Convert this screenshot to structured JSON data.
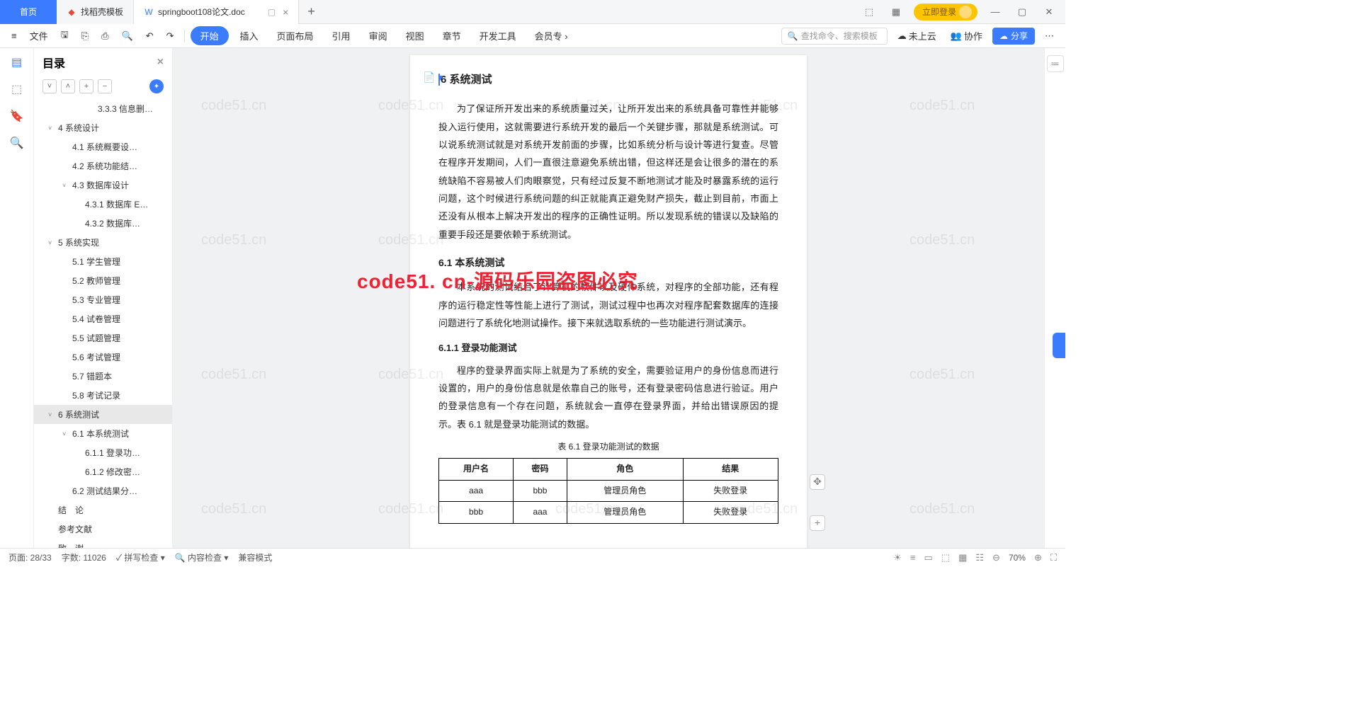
{
  "tabs": {
    "home": "首页",
    "t1": "找稻壳模板",
    "t2": "springboot108论文.doc"
  },
  "login": "立即登录",
  "toolbar": {
    "file": "文件",
    "menus": [
      "开始",
      "插入",
      "页面布局",
      "引用",
      "审阅",
      "视图",
      "章节",
      "开发工具",
      "会员专"
    ],
    "search_ph": "查找命令、搜索模板",
    "cloud": "未上云",
    "collab": "协作",
    "share": "分享"
  },
  "sidebar": {
    "title": "目录"
  },
  "toc": [
    {
      "t": "3.3.3 信息删…",
      "lvl": 4
    },
    {
      "t": "4 系统设计",
      "lvl": 1,
      "ch": "˅"
    },
    {
      "t": "4.1 系统概要设…",
      "lvl": 2
    },
    {
      "t": "4.2 系统功能结…",
      "lvl": 2
    },
    {
      "t": "4.3 数据库设计",
      "lvl": 2,
      "ch": "˅"
    },
    {
      "t": "4.3.1 数据库 E…",
      "lvl": 3
    },
    {
      "t": "4.3.2 数据库…",
      "lvl": 3
    },
    {
      "t": "5 系统实现",
      "lvl": 1,
      "ch": "˅"
    },
    {
      "t": "5.1 学生管理",
      "lvl": 2
    },
    {
      "t": "5.2 教师管理",
      "lvl": 2
    },
    {
      "t": "5.3 专业管理",
      "lvl": 2
    },
    {
      "t": "5.4 试卷管理",
      "lvl": 2
    },
    {
      "t": "5.5 试题管理",
      "lvl": 2
    },
    {
      "t": "5.6 考试管理",
      "lvl": 2
    },
    {
      "t": "5.7 错题本",
      "lvl": 2
    },
    {
      "t": "5.8 考试记录",
      "lvl": 2
    },
    {
      "t": "6 系统测试",
      "lvl": 1,
      "ch": "˅",
      "active": true
    },
    {
      "t": "6.1 本系统测试",
      "lvl": 2,
      "ch": "˅"
    },
    {
      "t": "6.1.1 登录功…",
      "lvl": 3
    },
    {
      "t": "6.1.2 修改密…",
      "lvl": 3
    },
    {
      "t": "6.2 测试结果分…",
      "lvl": 2
    },
    {
      "t": "结　论",
      "lvl": 1
    },
    {
      "t": "参考文献",
      "lvl": 1
    },
    {
      "t": "致　谢",
      "lvl": 1
    }
  ],
  "doc": {
    "h1": "6 系统测试",
    "p1": "为了保证所开发出来的系统质量过关，让所开发出来的系统具备可靠性并能够投入运行使用，这就需要进行系统开发的最后一个关键步骤，那就是系统测试。可以说系统测试就是对系统开发前面的步骤，比如系统分析与设计等进行复查。尽管在程序开发期间，人们一直很注意避免系统出错，但这样还是会让很多的潜在的系统缺陷不容易被人们肉眼察觉，只有经过反复不断地测试才能及时暴露系统的运行问题，这个时候进行系统问题的纠正就能真正避免财产损失，截止到目前，市面上还没有从根本上解决开发出的程序的正确性证明。所以发现系统的错误以及缺陷的重要手段还是要依赖于系统测试。",
    "h2": "6.1  本系统测试",
    "p2": "本系统的测试结合了计算机的软件以及硬件系统，对程序的全部功能，还有程序的运行稳定性等性能上进行了测试，测试过程中也再次对程序配套数据库的连接问题进行了系统化地测试操作。接下来就选取系统的一些功能进行测试演示。",
    "h3": "6.1.1 登录功能测试",
    "p3": "程序的登录界面实际上就是为了系统的安全，需要验证用户的身份信息而进行设置的，用户的身份信息就是依靠自己的账号，还有登录密码信息进行验证。用户的登录信息有一个存在问题，系统就会一直停在登录界面，并给出错误原因的提示。表 6.1 就是登录功能测试的数据。",
    "tbl_cap": "表 6.1  登录功能测试的数据",
    "th": [
      "用户名",
      "密码",
      "角色",
      "结果"
    ],
    "rows": [
      [
        "aaa",
        "bbb",
        "管理员角色",
        "失败登录"
      ],
      [
        "bbb",
        "aaa",
        "管理员角色",
        "失败登录"
      ]
    ]
  },
  "wm_red": "code51. cn-源码乐园盗图必究",
  "wm_gray": "code51.cn",
  "status": {
    "page": "页面: 28/33",
    "words": "字数: 11026",
    "spell": "拼写检查",
    "content": "内容检查",
    "compat": "兼容模式",
    "zoom": "70%"
  }
}
